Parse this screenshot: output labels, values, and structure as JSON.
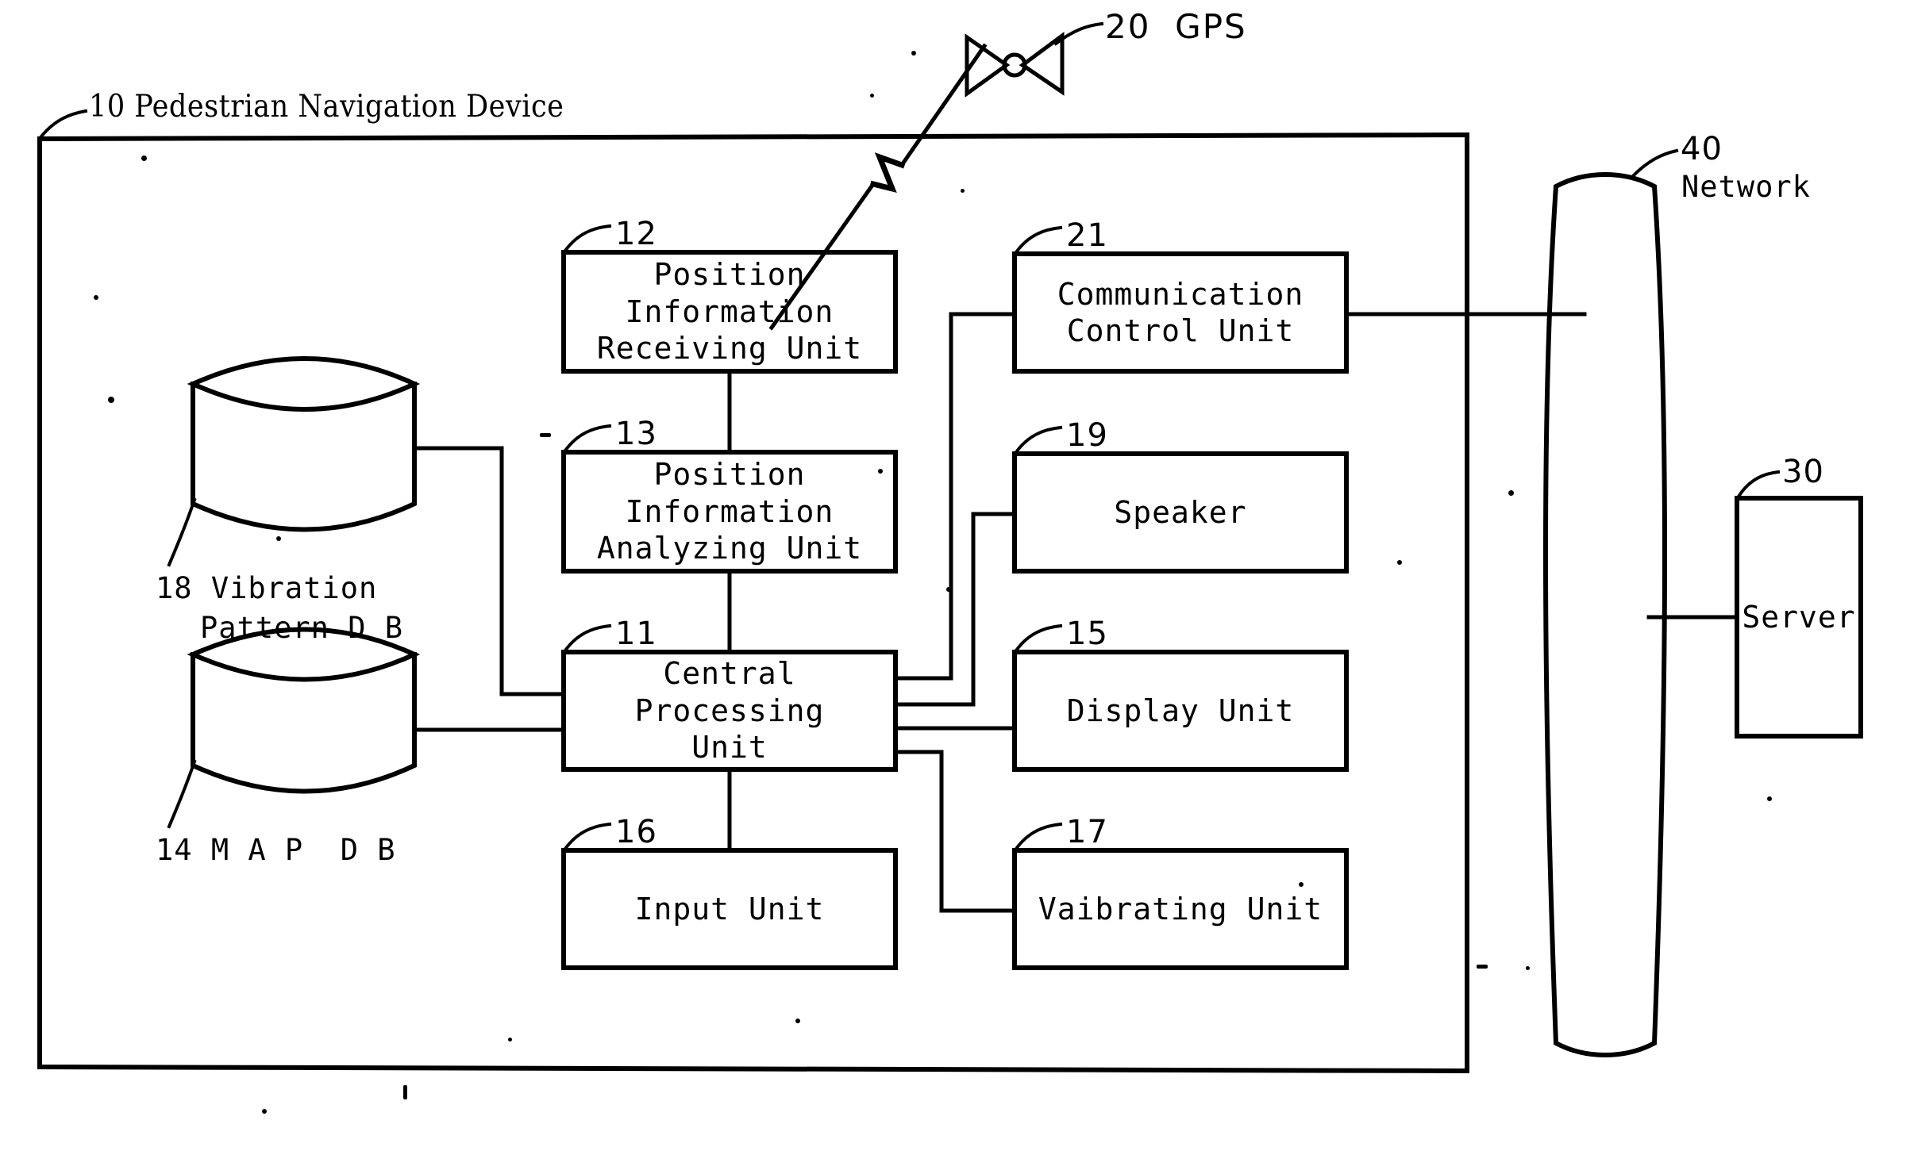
{
  "figure": {
    "kind": "patent-block-diagram",
    "background_color": "#ffffff",
    "line_color": "#000000"
  },
  "device_frame": {
    "ref": "10",
    "label": "Pedestrian Navigation Device",
    "full_label": "10 Pedestrian Navigation Device"
  },
  "gps": {
    "ref": "20",
    "label": "GPS",
    "full_label": "20  GPS",
    "icon": "satellite-bowtie-icon"
  },
  "network": {
    "ref": "40",
    "label": "Network"
  },
  "server": {
    "ref": "30",
    "label": "Server"
  },
  "databases": [
    {
      "ref": "18",
      "name": "vibration-pattern-db",
      "label_line1": "18 Vibration",
      "label_line2": "Pattern D B",
      "icon": "cylinder-database-icon"
    },
    {
      "ref": "14",
      "name": "map-db",
      "label_line1": "14 M A P  D B",
      "label_line2": "",
      "icon": "cylinder-database-icon"
    }
  ],
  "blocks": [
    {
      "ref": "12",
      "name": "position-information-receiving-unit",
      "label": "Position\nInformation\nReceiving Unit"
    },
    {
      "ref": "13",
      "name": "position-information-analyzing-unit",
      "label": "Position\nInformation\nAnalyzing Unit"
    },
    {
      "ref": "11",
      "name": "central-processing-unit",
      "label": "Central\nProcessing\nUnit"
    },
    {
      "ref": "16",
      "name": "input-unit",
      "label": "Input Unit"
    },
    {
      "ref": "21",
      "name": "communication-control-unit",
      "label": "Communication\nControl Unit"
    },
    {
      "ref": "19",
      "name": "speaker",
      "label": "Speaker"
    },
    {
      "ref": "15",
      "name": "display-unit",
      "label": "Display Unit"
    },
    {
      "ref": "17",
      "name": "vaibrating-unit",
      "label": "Vaibrating Unit"
    }
  ]
}
